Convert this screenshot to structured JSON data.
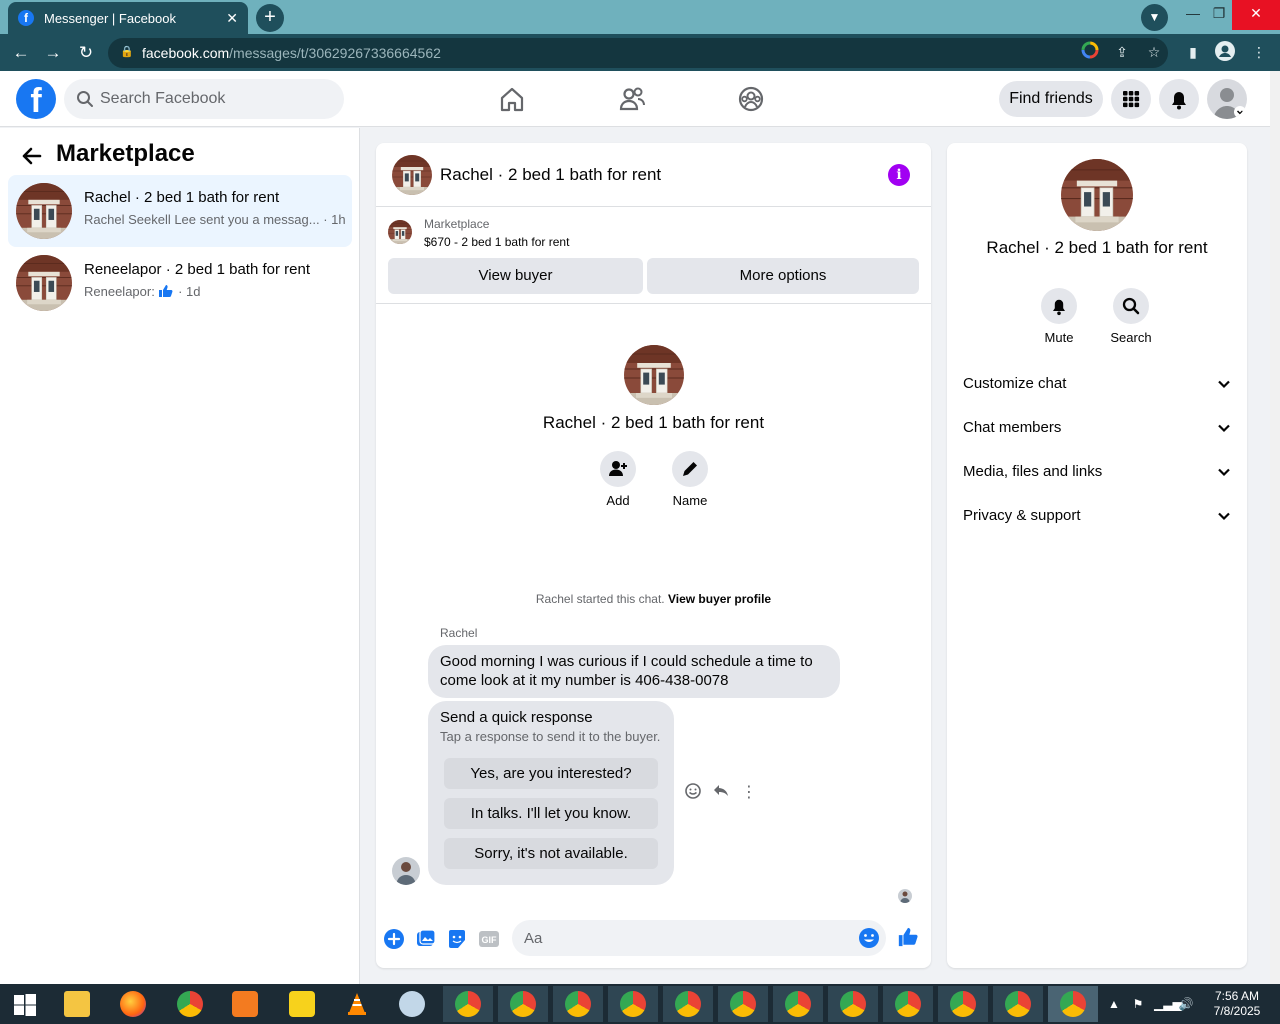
{
  "browser": {
    "tab_title": "Messenger | Facebook",
    "url_host": "facebook.com",
    "url_path": "/messages/t/30629267336664562"
  },
  "header": {
    "search_placeholder": "Search Facebook",
    "find_friends": "Find friends"
  },
  "sidebar": {
    "title": "Marketplace",
    "conversations": [
      {
        "name": "Rachel · 2 bed 1 bath for rent",
        "preview": "Rachel Seekell Lee sent you a messag... · 1h"
      },
      {
        "name": "Reneelapor · 2 bed 1 bath for rent",
        "preview_prefix": "Reneelapor:",
        "preview_time": "· 1d"
      }
    ]
  },
  "chat": {
    "title": "Rachel · 2 bed 1 bath for rent",
    "listing_label": "Marketplace",
    "listing_price": "$670 - 2 bed 1 bath for rent",
    "view_buyer": "View buyer",
    "more_options": "More options",
    "profile_name": "Rachel · 2 bed 1 bath for rent",
    "add_label": "Add",
    "name_label": "Name",
    "started_text": "Rachel started this chat.",
    "view_buyer_profile": "View buyer profile",
    "sender": "Rachel",
    "message": "Good morning I was curious if I could schedule a time to come look at it my number is 406-438-0078",
    "quick_title": "Send a quick response",
    "quick_sub": "Tap a response to send it to the buyer.",
    "quick_responses": [
      "Yes, are you interested?",
      "In talks. I'll let you know.",
      "Sorry, it's not available."
    ],
    "composer_placeholder": "Aa"
  },
  "right_panel": {
    "name": "Rachel · 2 bed 1 bath for rent",
    "mute": "Mute",
    "search": "Search",
    "sections": [
      "Customize chat",
      "Chat members",
      "Media, files and links",
      "Privacy & support"
    ]
  },
  "taskbar": {
    "time": "7:56 AM",
    "date": "7/8/2025"
  },
  "colors": {
    "fb_blue": "#1877f2",
    "active_conv": "#ebf5ff",
    "info_purple": "#a100f2",
    "chrome_dark": "#1f4f5c"
  }
}
